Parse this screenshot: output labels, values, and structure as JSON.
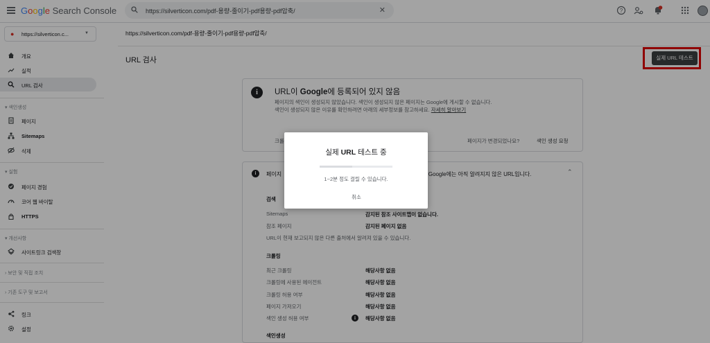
{
  "topbar": {
    "brand_google": "Google",
    "brand_product": "Search Console",
    "search_value": "https://silverticon.com/pdf-용량-줄이기-pdf용량-pdf압축/",
    "icons": [
      "menu-icon",
      "search-icon",
      "clear-icon",
      "help-icon",
      "manage-users-icon",
      "notifications-icon",
      "apps-icon",
      "account-avatar"
    ]
  },
  "sidebar": {
    "property": "https://silverticon.c...",
    "items_top": [
      {
        "label": "개요",
        "icon": "home-icon"
      },
      {
        "label": "실적",
        "icon": "trending-icon"
      },
      {
        "label": "URL 검사",
        "icon": "search-icon"
      }
    ],
    "section_index": "색인생성",
    "items_index": [
      {
        "label": "페이지",
        "icon": "pages-icon"
      },
      {
        "label": "Sitemaps",
        "icon": "sitemaps-icon"
      },
      {
        "label": "삭제",
        "icon": "removals-icon"
      }
    ],
    "section_experience": "실험",
    "items_experience": [
      {
        "label": "페이지 경험",
        "icon": "page-experience-icon"
      },
      {
        "label": "코어 웹 바이탈",
        "icon": "core-web-vitals-icon"
      },
      {
        "label": "HTTPS",
        "icon": "lock-icon"
      }
    ],
    "section_enhancements": "개선사항",
    "items_enhancements": [
      {
        "label": "사이트링크 검색창",
        "icon": "sitelinks-icon"
      }
    ],
    "section_security": "보안 및 직접 조치",
    "section_legacy": "기존 도구 및 보고서",
    "items_bottom": [
      {
        "label": "링크",
        "icon": "links-icon"
      },
      {
        "label": "설정",
        "icon": "settings-icon"
      }
    ]
  },
  "main": {
    "breadcrumb": "https://silverticon.com/pdf-용량-줄이기-pdf용량-pdf압축/",
    "title": "URL 검사",
    "live_test_button": "실제 URL 테스트",
    "status_card": {
      "title_prefix": "URL이 ",
      "title_bold": "Google",
      "title_suffix": "에 등록되어 있지 않음",
      "description": "페이지의 색인이 생성되지 않았습니다. 색인이 생성되지 않은 페이지는 Google에 게시할 수 없습니다. 색인이 생성되지 않은 이유를 확인하려면 아래의 세부정보를 참고하세요.",
      "learn_more": "자세히 알아보기",
      "left_truncated": "크롤",
      "changed_question": "페이지가 변경되었나요?",
      "request_indexing": "색인 생성 요청"
    },
    "detail_card": {
      "header_left": "페이지",
      "header_right": "음: Google에는 아직 알려지지 않은 URL입니다.",
      "discovery_heading": "검색",
      "discovery_rows": [
        {
          "label": "Sitemaps",
          "value": "감지된 참조 사이트맵이 없습니다."
        },
        {
          "label": "참조 페이지",
          "value": "감지된 페이지 없음"
        }
      ],
      "discovery_note": "URL이 현재 보고되지 않은 다른 출처에서 알려져 있을 수 있습니다.",
      "crawl_heading": "크롤링",
      "crawl_rows": [
        {
          "label": "최근 크롤링",
          "value": "해당사항 없음"
        },
        {
          "label": "크롤링에 사용된 에이전트",
          "value": "해당사항 없음"
        },
        {
          "label": "크롤링 허용 여부",
          "value": "해당사항 없음"
        },
        {
          "label": "페이지 가져오기",
          "value": "해당사항 없음"
        },
        {
          "label": "색인 생성 허용 여부",
          "value": "해당사항 없음"
        }
      ],
      "index_heading": "색인생성"
    }
  },
  "dialog": {
    "title_prefix": "실제 ",
    "title_bold": "URL",
    "title_suffix": " 테스트 중",
    "progress": 0.45,
    "note": "1~2분 정도 걸릴 수 있습니다.",
    "cancel": "취소"
  },
  "colors": {
    "highlight_box": "#e00000",
    "primary_button": "#3c4043",
    "active_nav": "#e8eaed"
  }
}
